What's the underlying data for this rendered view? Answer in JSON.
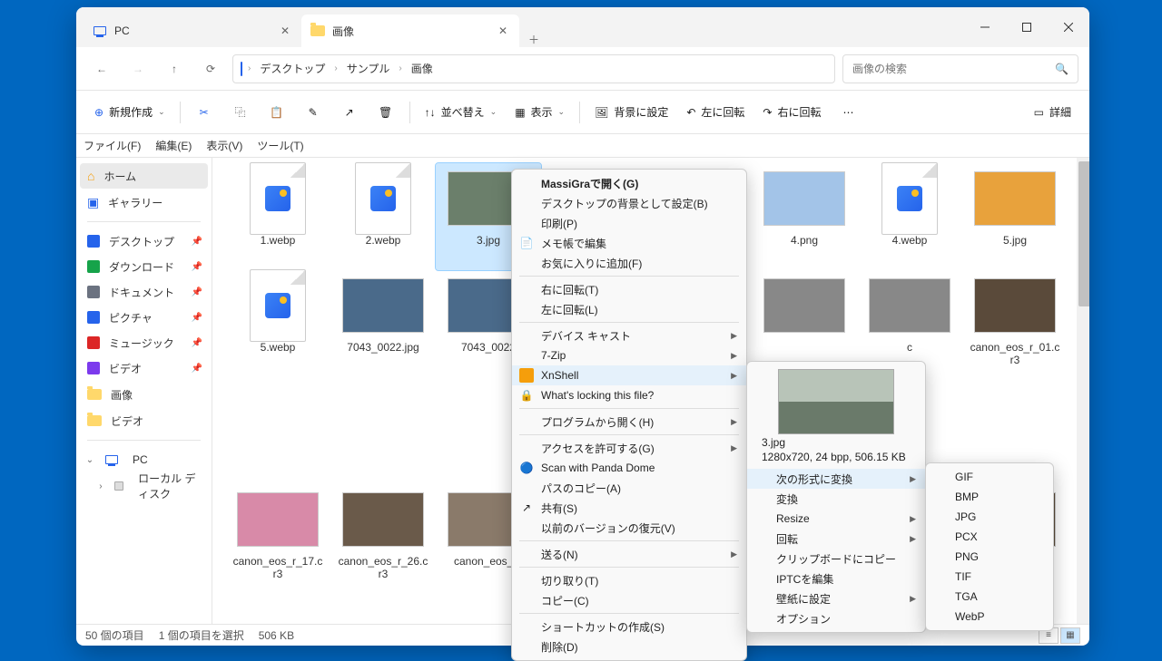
{
  "tabs": [
    {
      "label": "PC"
    },
    {
      "label": "画像"
    }
  ],
  "breadcrumb": [
    "デスクトップ",
    "サンプル",
    "画像"
  ],
  "search": {
    "placeholder": "画像の検索"
  },
  "toolbar": {
    "new": "新規作成",
    "sort": "並べ替え",
    "view": "表示",
    "bg": "背景に設定",
    "rotL": "左に回転",
    "rotR": "右に回転",
    "details": "詳細"
  },
  "menubar": [
    "ファイル(F)",
    "編集(E)",
    "表示(V)",
    "ツール(T)"
  ],
  "sidebar": {
    "home": "ホーム",
    "gallery": "ギャラリー",
    "pinned": [
      {
        "label": "デスクトップ",
        "color": "#2563eb"
      },
      {
        "label": "ダウンロード",
        "color": "#16a34a"
      },
      {
        "label": "ドキュメント",
        "color": "#6b7280"
      },
      {
        "label": "ピクチャ",
        "color": "#2563eb"
      },
      {
        "label": "ミュージック",
        "color": "#dc2626"
      },
      {
        "label": "ビデオ",
        "color": "#7c3aed"
      }
    ],
    "folders": [
      {
        "label": "画像"
      },
      {
        "label": "ビデオ"
      }
    ],
    "pc": "PC",
    "disk": "ローカル ディスク"
  },
  "files": [
    {
      "name": "1.webp",
      "type": "doc"
    },
    {
      "name": "2.webp",
      "type": "doc"
    },
    {
      "name": "3.jpg",
      "type": "img",
      "sel": true,
      "bg": "#6b7f6b"
    },
    {
      "name": "",
      "type": "blank"
    },
    {
      "name": "",
      "type": "blank"
    },
    {
      "name": "4.png",
      "type": "img",
      "bg": "#a3c4e8"
    },
    {
      "name": "4.webp",
      "type": "doc"
    },
    {
      "name": "5.jpg",
      "type": "img",
      "bg": "#e8a23c"
    },
    {
      "name": "5.webp",
      "type": "doc"
    },
    {
      "name": "7043_0022.jpg",
      "type": "img",
      "bg": "#4a6a8a"
    },
    {
      "name": "7043_0022",
      "type": "img",
      "bg": "#4a6a8a"
    },
    {
      "name": "",
      "type": "blank"
    },
    {
      "name": "",
      "type": "blank"
    },
    {
      "name": "",
      "type": "img",
      "bg": "#888"
    },
    {
      "name": "c",
      "type": "img",
      "bg": "#888"
    },
    {
      "name": "canon_eos_r_01.cr3",
      "type": "img",
      "bg": "#5a4a3a"
    },
    {
      "name": "",
      "type": "blank"
    },
    {
      "name": "",
      "type": "blank"
    },
    {
      "name": "",
      "type": "blank"
    },
    {
      "name": "",
      "type": "blank"
    },
    {
      "name": "",
      "type": "blank"
    },
    {
      "name": "",
      "type": "blank"
    },
    {
      "name": "",
      "type": "blank"
    },
    {
      "name": "",
      "type": "blank"
    },
    {
      "name": "canon_eos_r_17.cr3",
      "type": "img",
      "bg": "#d88aa8"
    },
    {
      "name": "canon_eos_r_26.cr3",
      "type": "img",
      "bg": "#6a5a4a"
    },
    {
      "name": "canon_eos_r_",
      "type": "img",
      "bg": "#8a7a6a"
    },
    {
      "name": "",
      "type": "blank"
    },
    {
      "name": "",
      "type": "blank"
    },
    {
      "name": "",
      "type": "blank"
    },
    {
      "name": "",
      "type": "img",
      "bg": "#3a5a3a"
    },
    {
      "name": "",
      "type": "img",
      "bg": "#5a4a3a"
    }
  ],
  "status": {
    "count": "50 個の項目",
    "sel": "1 個の項目を選択",
    "size": "506 KB"
  },
  "ctx1": [
    {
      "t": "MassiGraで開く(G)",
      "b": true
    },
    {
      "t": "デスクトップの背景として設定(B)"
    },
    {
      "t": "印刷(P)"
    },
    {
      "t": "メモ帳で編集",
      "i": "note"
    },
    {
      "t": "お気に入りに追加(F)"
    },
    {
      "sep": true
    },
    {
      "t": "右に回転(T)"
    },
    {
      "t": "左に回転(L)"
    },
    {
      "sep": true
    },
    {
      "t": "デバイス キャスト",
      "sub": true
    },
    {
      "t": "7-Zip",
      "sub": true
    },
    {
      "t": "XnShell",
      "sub": true,
      "hover": true,
      "i": "xn"
    },
    {
      "t": "What's locking this file?",
      "i": "lock"
    },
    {
      "sep": true
    },
    {
      "t": "プログラムから開く(H)",
      "sub": true
    },
    {
      "sep": true
    },
    {
      "t": "アクセスを許可する(G)",
      "sub": true
    },
    {
      "t": "Scan with Panda Dome",
      "i": "panda"
    },
    {
      "t": "パスのコピー(A)"
    },
    {
      "t": "共有(S)",
      "i": "share"
    },
    {
      "t": "以前のバージョンの復元(V)"
    },
    {
      "sep": true
    },
    {
      "t": "送る(N)",
      "sub": true
    },
    {
      "sep": true
    },
    {
      "t": "切り取り(T)"
    },
    {
      "t": "コピー(C)"
    },
    {
      "sep": true
    },
    {
      "t": "ショートカットの作成(S)"
    },
    {
      "t": "削除(D)"
    }
  ],
  "ctx2": {
    "preview": {
      "name": "3.jpg",
      "meta": "1280x720, 24 bpp, 506.15 KB"
    },
    "items": [
      {
        "t": "次の形式に変換",
        "sub": true,
        "hover": true
      },
      {
        "t": "変換"
      },
      {
        "t": "Resize",
        "sub": true
      },
      {
        "t": "回転",
        "sub": true
      },
      {
        "t": "クリップボードにコピー"
      },
      {
        "t": "IPTCを編集"
      },
      {
        "t": "壁紙に設定",
        "sub": true
      },
      {
        "t": "オプション"
      }
    ]
  },
  "ctx3": [
    "GIF",
    "BMP",
    "JPG",
    "PCX",
    "PNG",
    "TIF",
    "TGA",
    "WebP"
  ]
}
